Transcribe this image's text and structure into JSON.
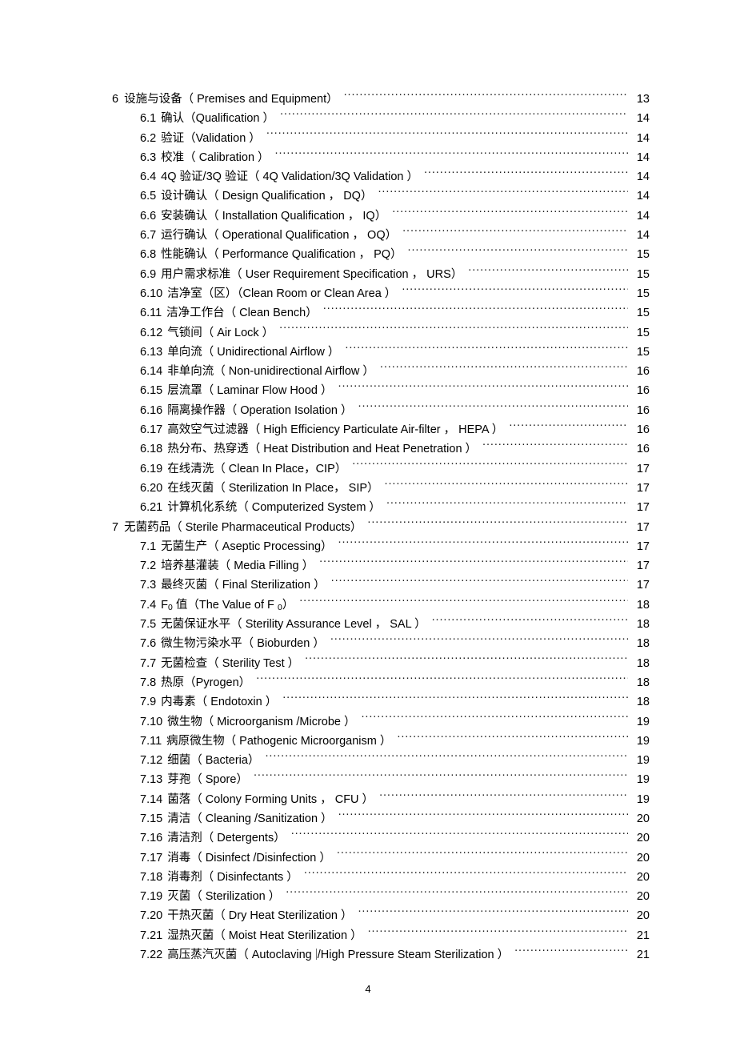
{
  "document": {
    "page_number": "4",
    "kind": "table-of-contents"
  },
  "toc": {
    "entries": [
      {
        "level": 1,
        "num": "6",
        "title": "设施与设备（ Premises and Equipment）",
        "page": "13"
      },
      {
        "level": 2,
        "num": "6.1",
        "title": "确认（Qualification ）",
        "page": "14"
      },
      {
        "level": 2,
        "num": "6.2",
        "title": "验证（Validation ）",
        "page": "14"
      },
      {
        "level": 2,
        "num": "6.3",
        "title": "校准（ Calibration ）",
        "page": "14"
      },
      {
        "level": 2,
        "num": "6.4",
        "title": "4Q 验证/3Q 验证（ 4Q Validation/3Q Validation  ）",
        "page": "14"
      },
      {
        "level": 2,
        "num": "6.5",
        "title": "设计确认（ Design Qualification ， DQ）",
        "page": "14"
      },
      {
        "level": 2,
        "num": "6.6",
        "title": "安装确认（ Installation Qualification  ， IQ）",
        "page": "14"
      },
      {
        "level": 2,
        "num": "6.7",
        "title": "运行确认（ Operational Qualification ， OQ）",
        "page": "14"
      },
      {
        "level": 2,
        "num": "6.8",
        "title": "性能确认（ Performance Qualification ， PQ）",
        "page": "15"
      },
      {
        "level": 2,
        "num": "6.9",
        "title": "用户需求标准（ User Requirement Specification ， URS）",
        "page": "15"
      },
      {
        "level": 2,
        "num": "6.10",
        "title": "洁净室（区）（Clean Room or Clean Area ）",
        "page": "15"
      },
      {
        "level": 2,
        "num": "6.11",
        "title": "洁净工作台（ Clean Bench）",
        "page": "15"
      },
      {
        "level": 2,
        "num": "6.12",
        "title": "气锁间（ Air Lock ）",
        "page": "15"
      },
      {
        "level": 2,
        "num": "6.13",
        "title": "单向流（ Unidirectional Airflow  ）",
        "page": "15"
      },
      {
        "level": 2,
        "num": "6.14",
        "title": "非单向流（ Non-unidirectional Airflow   ）",
        "page": "16"
      },
      {
        "level": 2,
        "num": "6.15",
        "title": "层流罩（ Laminar Flow Hood ）",
        "page": "16"
      },
      {
        "level": 2,
        "num": "6.16",
        "title": "隔离操作器（ Operation Isolation ）",
        "page": "16"
      },
      {
        "level": 2,
        "num": "6.17",
        "title": "高效空气过滤器（  High Efficiency Particulate Air-filter  ， HEPA ）",
        "page": "16"
      },
      {
        "level": 2,
        "num": "6.18",
        "title": "热分布、热穿透（  Heat Distribution and Heat Penetration ）",
        "page": "16"
      },
      {
        "level": 2,
        "num": "6.19",
        "title": "在线清洗（ Clean In Place，CIP）",
        "page": "17"
      },
      {
        "level": 2,
        "num": "6.20",
        "title": "在线灭菌（ Sterilization In Place， SIP）",
        "page": "17"
      },
      {
        "level": 2,
        "num": "6.21",
        "title": "计算机化系统（ Computerized System ）",
        "page": "17"
      },
      {
        "level": 1,
        "num": "7",
        "title": "无菌药品（ Sterile Pharmaceutical Products）",
        "page": "17"
      },
      {
        "level": 2,
        "num": "7.1",
        "title": "无菌生产（ Aseptic Processing）",
        "page": "17"
      },
      {
        "level": 2,
        "num": "7.2",
        "title": "培养基灌装（ Media Filling ）",
        "page": "17"
      },
      {
        "level": 2,
        "num": "7.3",
        "title": "最终灭菌（ Final Sterilization ）",
        "page": "17"
      },
      {
        "level": 2,
        "num": "7.4",
        "title": "F0 值（The Value of F 0）",
        "page": "18",
        "html": "F<sub>0</sub> 值（The Value of F <sub>0</sub>）"
      },
      {
        "level": 2,
        "num": "7.5",
        "title": "无菌保证水平（ Sterility Assurance Level ， SAL ）",
        "page": "18"
      },
      {
        "level": 2,
        "num": "7.6",
        "title": "微生物污染水平（ Bioburden ）",
        "page": "18"
      },
      {
        "level": 2,
        "num": "7.7",
        "title": "无菌检查（ Sterility Test ）",
        "page": "18"
      },
      {
        "level": 2,
        "num": "7.8",
        "title": "热原（Pyrogen）",
        "page": "18"
      },
      {
        "level": 2,
        "num": "7.9",
        "title": "内毒素（ Endotoxin ）",
        "page": "18"
      },
      {
        "level": 2,
        "num": "7.10",
        "title": "微生物（ Microorganism /Microbe  ）",
        "page": "19"
      },
      {
        "level": 2,
        "num": "7.11",
        "title": "病原微生物（ Pathogenic Microorganism ）",
        "page": "19"
      },
      {
        "level": 2,
        "num": "7.12",
        "title": "细菌（ Bacteria）",
        "page": "19"
      },
      {
        "level": 2,
        "num": "7.13",
        "title": "芽孢（ Spore）",
        "page": "19"
      },
      {
        "level": 2,
        "num": "7.14",
        "title": "菌落（ Colony Forming Units ， CFU ）",
        "page": "19"
      },
      {
        "level": 2,
        "num": "7.15",
        "title": "清洁（ Cleaning /Sanitization ）",
        "page": "20"
      },
      {
        "level": 2,
        "num": "7.16",
        "title": "清洁剂（ Detergents）",
        "page": "20"
      },
      {
        "level": 2,
        "num": "7.17",
        "title": "消毒（ Disinfect /Disinfection  ）",
        "page": "20"
      },
      {
        "level": 2,
        "num": "7.18",
        "title": "消毒剂（ Disinfectants ）",
        "page": "20"
      },
      {
        "level": 2,
        "num": "7.19",
        "title": "灭菌（ Sterilization ）",
        "page": "20"
      },
      {
        "level": 2,
        "num": "7.20",
        "title": "干热灭菌（ Dry Heat Sterilization ）",
        "page": "20"
      },
      {
        "level": 2,
        "num": "7.21",
        "title": "湿热灭菌（ Moist Heat Sterilization ）",
        "page": "21"
      },
      {
        "level": 2,
        "num": "7.22",
        "title": "高压蒸汽灭菌（ Autoclaving /High Pressure Steam Sterilization ）",
        "page": "21",
        "html": "高压蒸汽灭菌（ Autoclaving <span class=\"caret\" data-name=\"text-caret\" data-interactable=\"false\"></span>/High Pressure Steam Sterilization ）"
      }
    ]
  }
}
